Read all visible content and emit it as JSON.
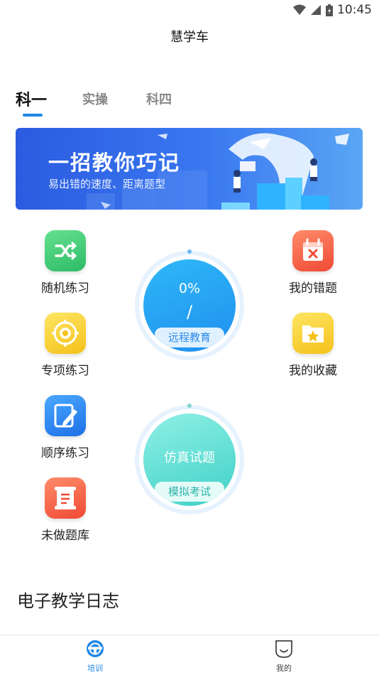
{
  "status_bar": {
    "time": "10:45"
  },
  "app_title": "慧学车",
  "tabs": [
    {
      "label": "科一",
      "active": true
    },
    {
      "label": "实操",
      "active": false
    },
    {
      "label": "科四",
      "active": false
    }
  ],
  "banner": {
    "title": "一招教你巧记",
    "subtitle": "易出错的速度、距离题型"
  },
  "features_left": [
    {
      "label": "随机练习",
      "icon": "shuffle-icon",
      "color": "#3cc873"
    },
    {
      "label": "专项练习",
      "icon": "target-icon",
      "color": "#f7cf2d"
    },
    {
      "label": "顺序练习",
      "icon": "edit-icon",
      "color": "#2f88f0"
    },
    {
      "label": "未做题库",
      "icon": "scroll-icon",
      "color": "#f45c43"
    }
  ],
  "features_right": [
    {
      "label": "我的错题",
      "icon": "wrong-calendar-icon",
      "color": "#f45c43"
    },
    {
      "label": "我的收藏",
      "icon": "star-folder-icon",
      "color": "#f7cf2d"
    }
  ],
  "remote_education": {
    "progress_text": "0%",
    "separator": "/",
    "label": "远程教育"
  },
  "simulation": {
    "title": "仿真试题",
    "label": "模拟考试"
  },
  "section_title": "电子教学日志",
  "bottom_nav": [
    {
      "label": "培训",
      "icon": "steering-wheel-icon",
      "active": true
    },
    {
      "label": "我的",
      "icon": "smiley-tag-icon",
      "active": false
    }
  ],
  "colors": {
    "accent": "#1e88e5"
  }
}
